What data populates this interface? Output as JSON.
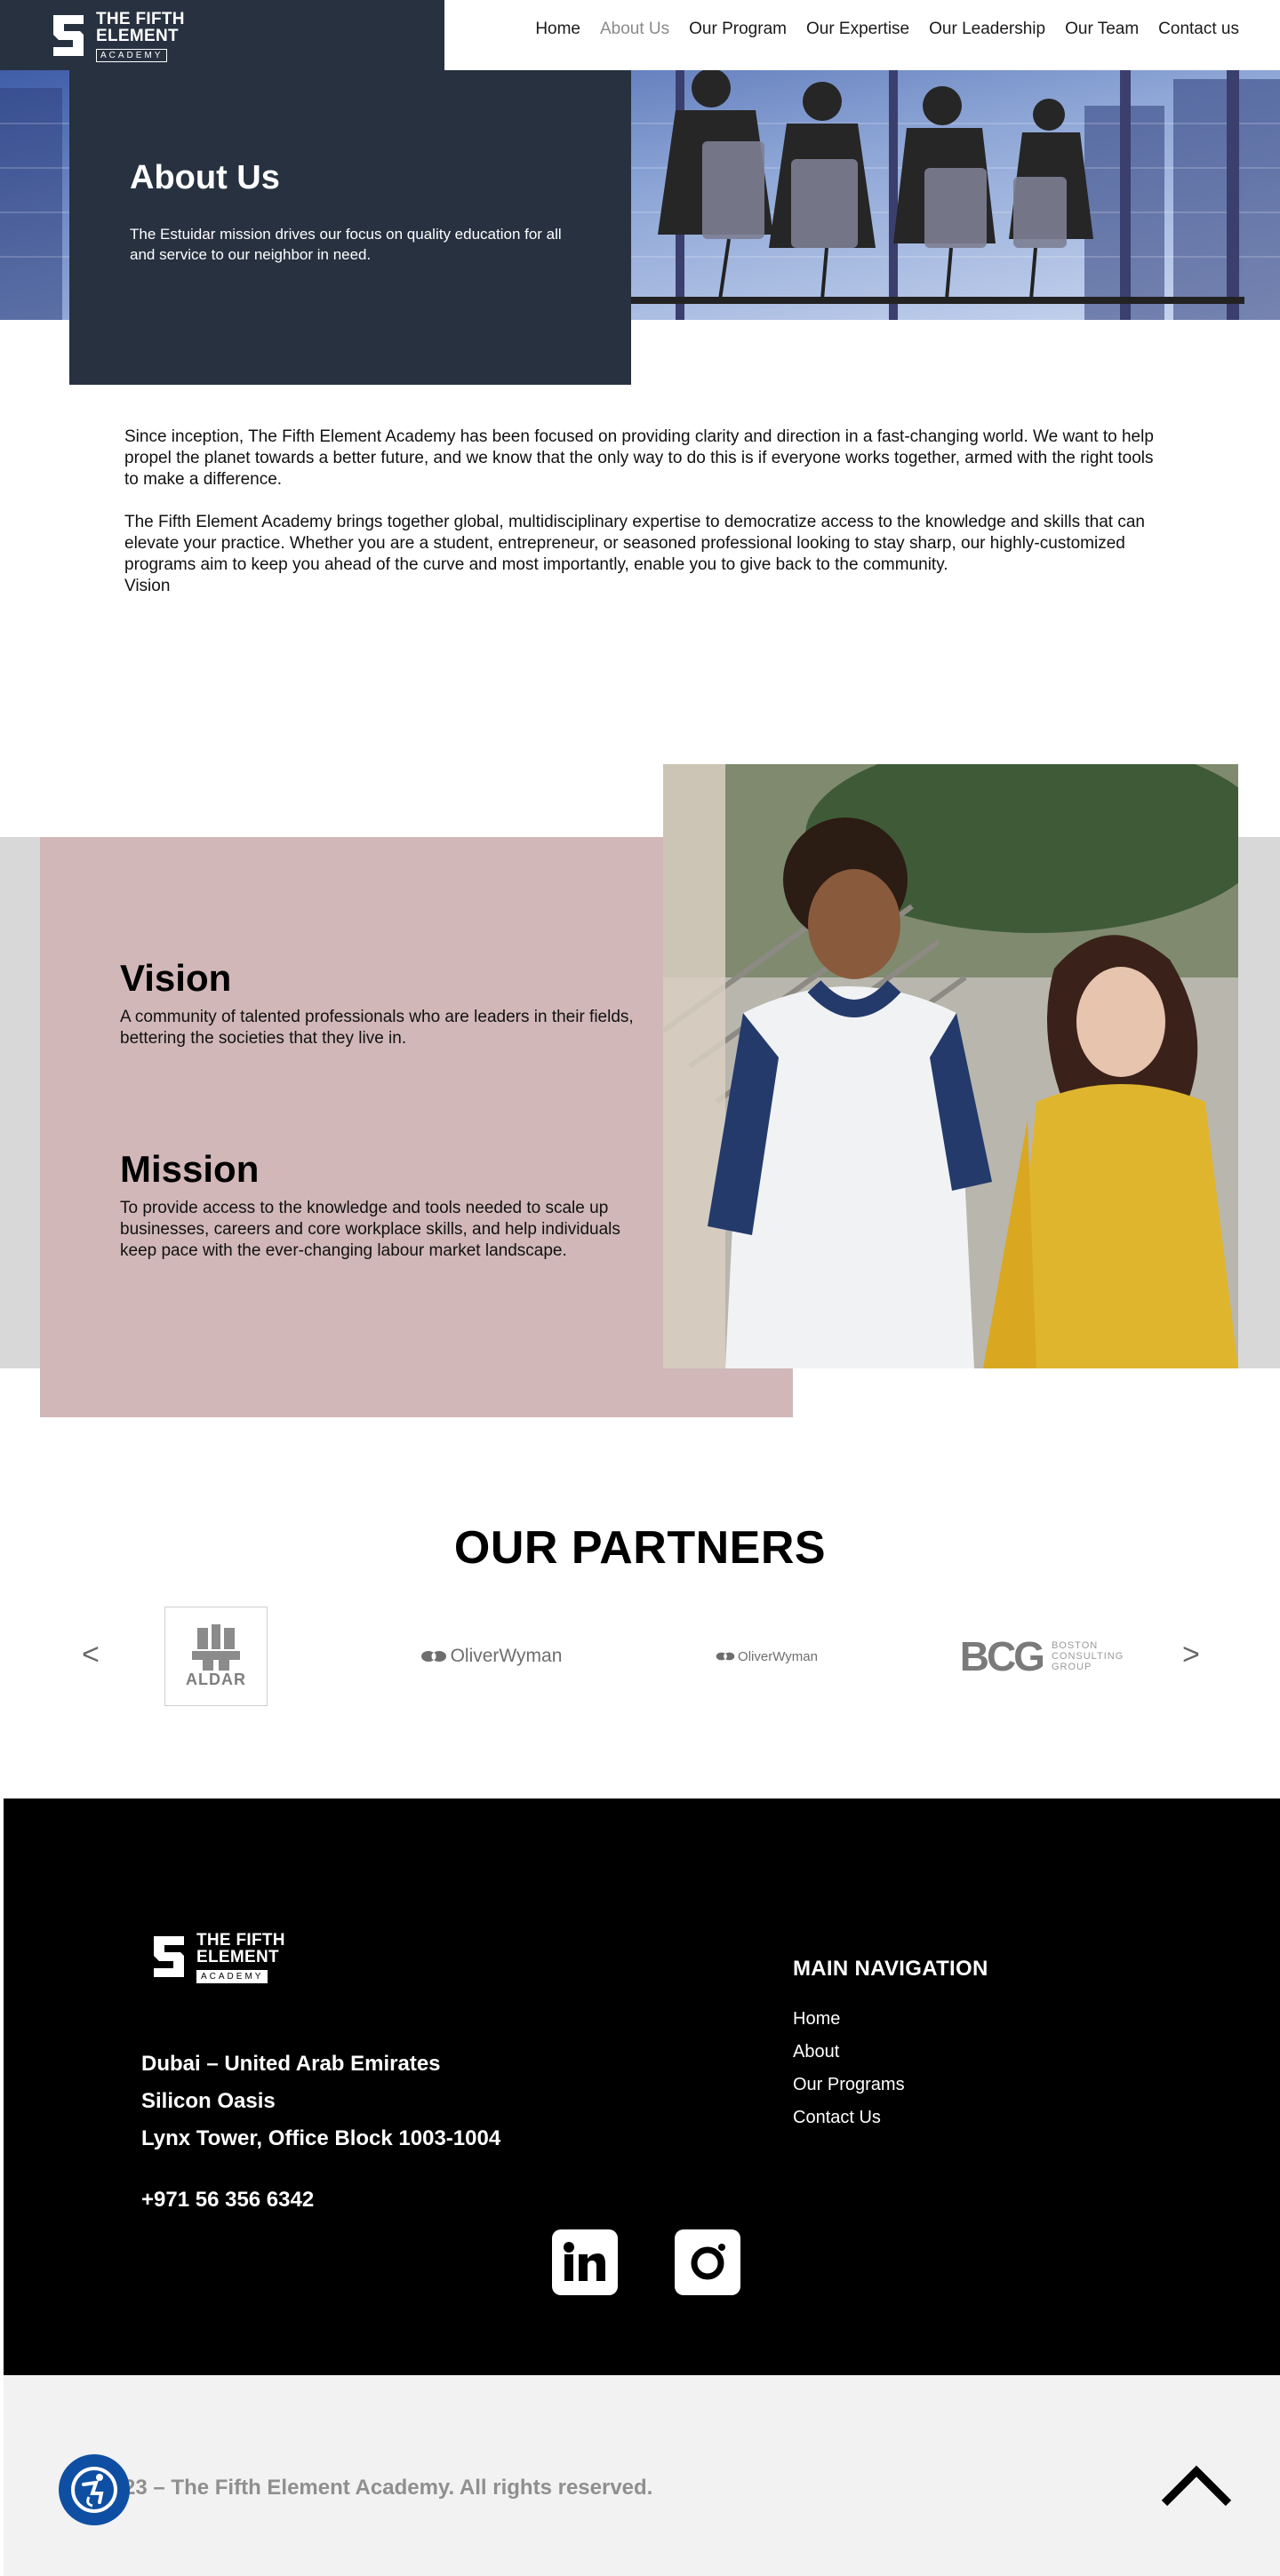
{
  "header": {
    "logo": {
      "line1": "THE FIFTH",
      "line2": "ELEMENT",
      "sub": "ACADEMY"
    },
    "nav": [
      {
        "label": "Home"
      },
      {
        "label": "About Us"
      },
      {
        "label": "Our Program"
      },
      {
        "label": "Our Expertise"
      },
      {
        "label": "Our Leadership"
      },
      {
        "label": "Our Team"
      },
      {
        "label": "Contact us"
      }
    ],
    "active_nav": "About Us"
  },
  "hero": {
    "title": "About Us",
    "subtitle": "The Estuidar mission drives our focus on quality education for all and service to our neighbor in need.",
    "image": "business-meeting-silhouette-photo"
  },
  "intro": {
    "p1": "Since inception, The Fifth Element Academy has been focused on providing clarity and direction in a fast-changing world. We want to help propel the planet towards a better future, and we know that the only way to do this is if everyone works together, armed with the right tools to make a difference.",
    "p2": "The Fifth Element Academy brings together global, multidisciplinary expertise to democratize access to the knowledge and skills that can elevate your practice. Whether you are a student, entrepreneur, or seasoned professional looking to stay sharp, our highly-customized programs aim to keep you ahead of the curve and most importantly, enable you to give back to the community.",
    "p3": "Vision"
  },
  "vision_mission": {
    "vision_title": "Vision",
    "vision_text": "A community of talented professionals who are leaders in their fields, bettering the societies that they live in.",
    "mission_title": "Mission",
    "mission_text": "To provide access to the knowledge and tools needed to scale up businesses, careers and core workplace skills, and help individuals keep pace with the ever-changing labour market landscape.",
    "image": "students-talking-photo"
  },
  "partners": {
    "title": "OUR PARTNERS",
    "prev": "<",
    "next": ">",
    "logos": [
      {
        "name": "ALDAR"
      },
      {
        "name": "OliverWyman"
      },
      {
        "name": "OliverWyman"
      },
      {
        "name": "BCG",
        "sub1": "BOSTON",
        "sub2": "CONSULTING",
        "sub3": "GROUP"
      }
    ]
  },
  "footer": {
    "address": [
      "Dubai – United Arab Emirates",
      "Silicon Oasis",
      "Lynx Tower, Office Block 1003-1004"
    ],
    "phone": "+971 56 356 6342",
    "nav_title": "MAIN NAVIGATION",
    "nav": [
      "Home",
      "About",
      "Our Programs",
      "Contact Us"
    ],
    "social": [
      "linkedin-icon",
      "instagram-icon"
    ],
    "copyright": "© 2023 – The Fifth Element Academy. All rights reserved."
  },
  "colors": {
    "navy": "#273140",
    "pink": "#d1b7b8",
    "grey": "#d8d8d8",
    "footer": "#000000",
    "a11y": "#0e4fa3"
  }
}
